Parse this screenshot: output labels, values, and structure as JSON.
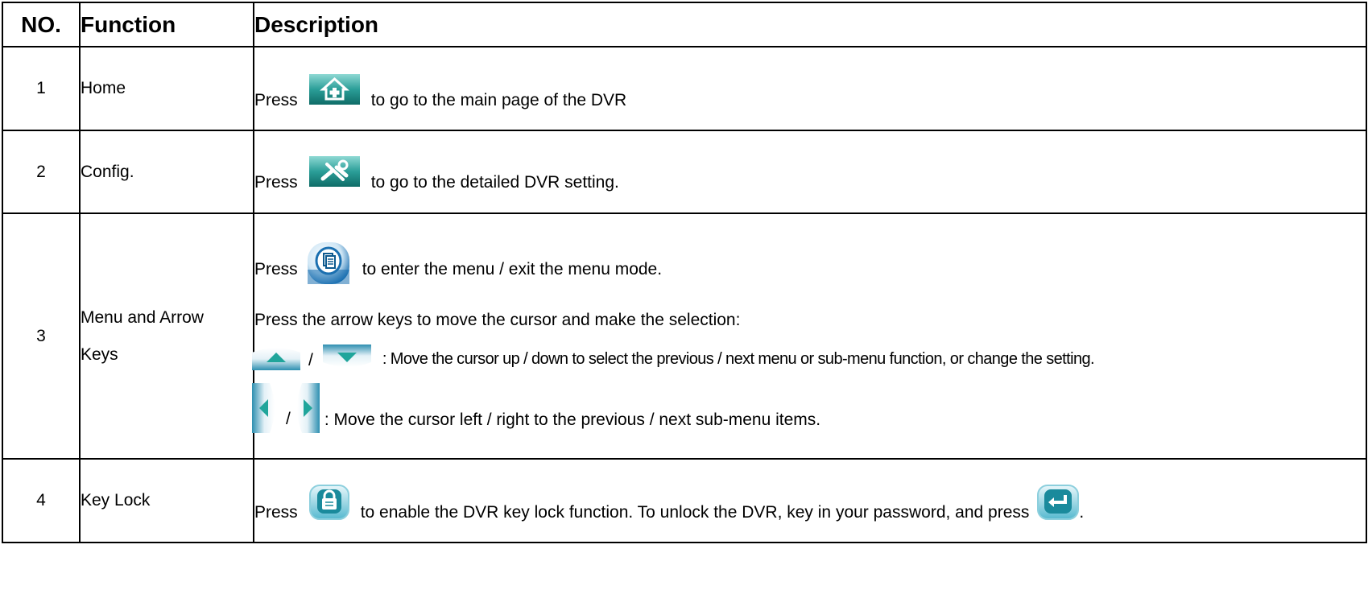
{
  "header": {
    "no": "NO.",
    "function": "Function",
    "description": "Description"
  },
  "rows": [
    {
      "no": "1",
      "function": "Home",
      "desc": {
        "press": "Press",
        "text": "to go to the main page of the DVR"
      }
    },
    {
      "no": "2",
      "function": "Config.",
      "desc": {
        "press": "Press",
        "text": "to go to the detailed DVR setting."
      }
    },
    {
      "no": "3",
      "function_line1": "Menu and Arrow",
      "function_line2": "Keys",
      "desc": {
        "press": "Press",
        "menu_text": "to enter the menu / exit the menu mode.",
        "arrow_intro": "Press the arrow keys to move the cursor and make the selection:",
        "slash": "/",
        "updown_text": ": Move the cursor up / down to select the previous / next menu or sub-menu function, or change the setting.",
        "leftright_text": ": Move the cursor left / right to the previous / next sub-menu items."
      }
    },
    {
      "no": "4",
      "function": "Key Lock",
      "desc": {
        "press": "Press",
        "text": "to enable the DVR key lock function. To unlock the DVR, key in your password, and press",
        "end": "."
      }
    }
  ],
  "icons": [
    "home-icon",
    "config-icon",
    "menu-icon",
    "up-arrow-icon",
    "down-arrow-icon",
    "left-arrow-icon",
    "right-arrow-icon",
    "key-lock-icon",
    "enter-icon"
  ],
  "colors": {
    "teal_light": "#7fd3cf",
    "teal": "#1c8e88",
    "teal_dark": "#0d5f5b",
    "menu_blue": "#1a6fb0"
  }
}
